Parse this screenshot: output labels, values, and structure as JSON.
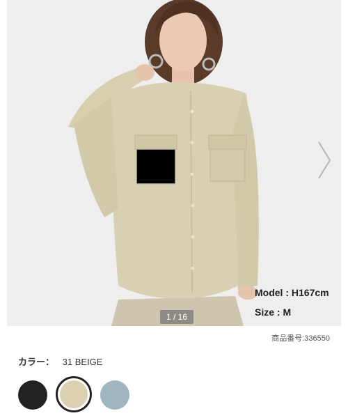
{
  "gallery": {
    "page_indicator": "1 / 16",
    "model_height": "Model : H167cm",
    "model_size": "Size : M",
    "current_image": 1,
    "total_images": 16
  },
  "product": {
    "number_label": "商品番号:336550"
  },
  "color_selector": {
    "label": "カラー：",
    "selected_name": "31 BEIGE",
    "swatches": [
      {
        "name": "black",
        "hex": "#222222",
        "selected": false
      },
      {
        "name": "beige",
        "hex": "#ddd1b4",
        "selected": true
      },
      {
        "name": "light-blue",
        "hex": "#9fb6c0",
        "selected": false
      }
    ]
  }
}
